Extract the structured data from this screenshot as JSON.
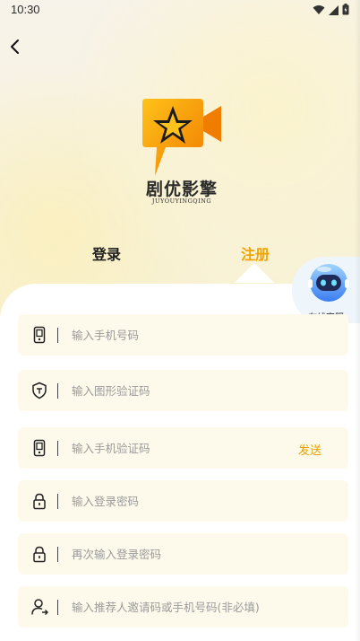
{
  "status_bar": {
    "time": "10:30"
  },
  "logo": {
    "title": "剧优影擎",
    "subtitle": "JUYOUYINGQING"
  },
  "tabs": [
    {
      "label": "登录",
      "active": false
    },
    {
      "label": "注册",
      "active": true
    }
  ],
  "customer_service": {
    "label": "在线客服"
  },
  "form": {
    "phone": {
      "placeholder": "输入手机号码",
      "value": "",
      "icon": "phone-icon"
    },
    "captcha": {
      "placeholder": "输入图形验证码",
      "value": "",
      "icon": "shield-icon"
    },
    "sms_code": {
      "placeholder": "输入手机验证码",
      "value": "",
      "icon": "phone-icon",
      "send_label": "发送"
    },
    "password": {
      "placeholder": "输入登录密码",
      "value": "",
      "icon": "lock-icon"
    },
    "password_confirm": {
      "placeholder": "再次输入登录密码",
      "value": "",
      "icon": "lock-icon"
    },
    "referrer": {
      "placeholder": "输入推荐人邀请码或手机号码(非必填)",
      "value": "",
      "icon": "user-add-icon"
    }
  },
  "colors": {
    "accent": "#f0a400",
    "field_bg": "#fdfaec"
  }
}
